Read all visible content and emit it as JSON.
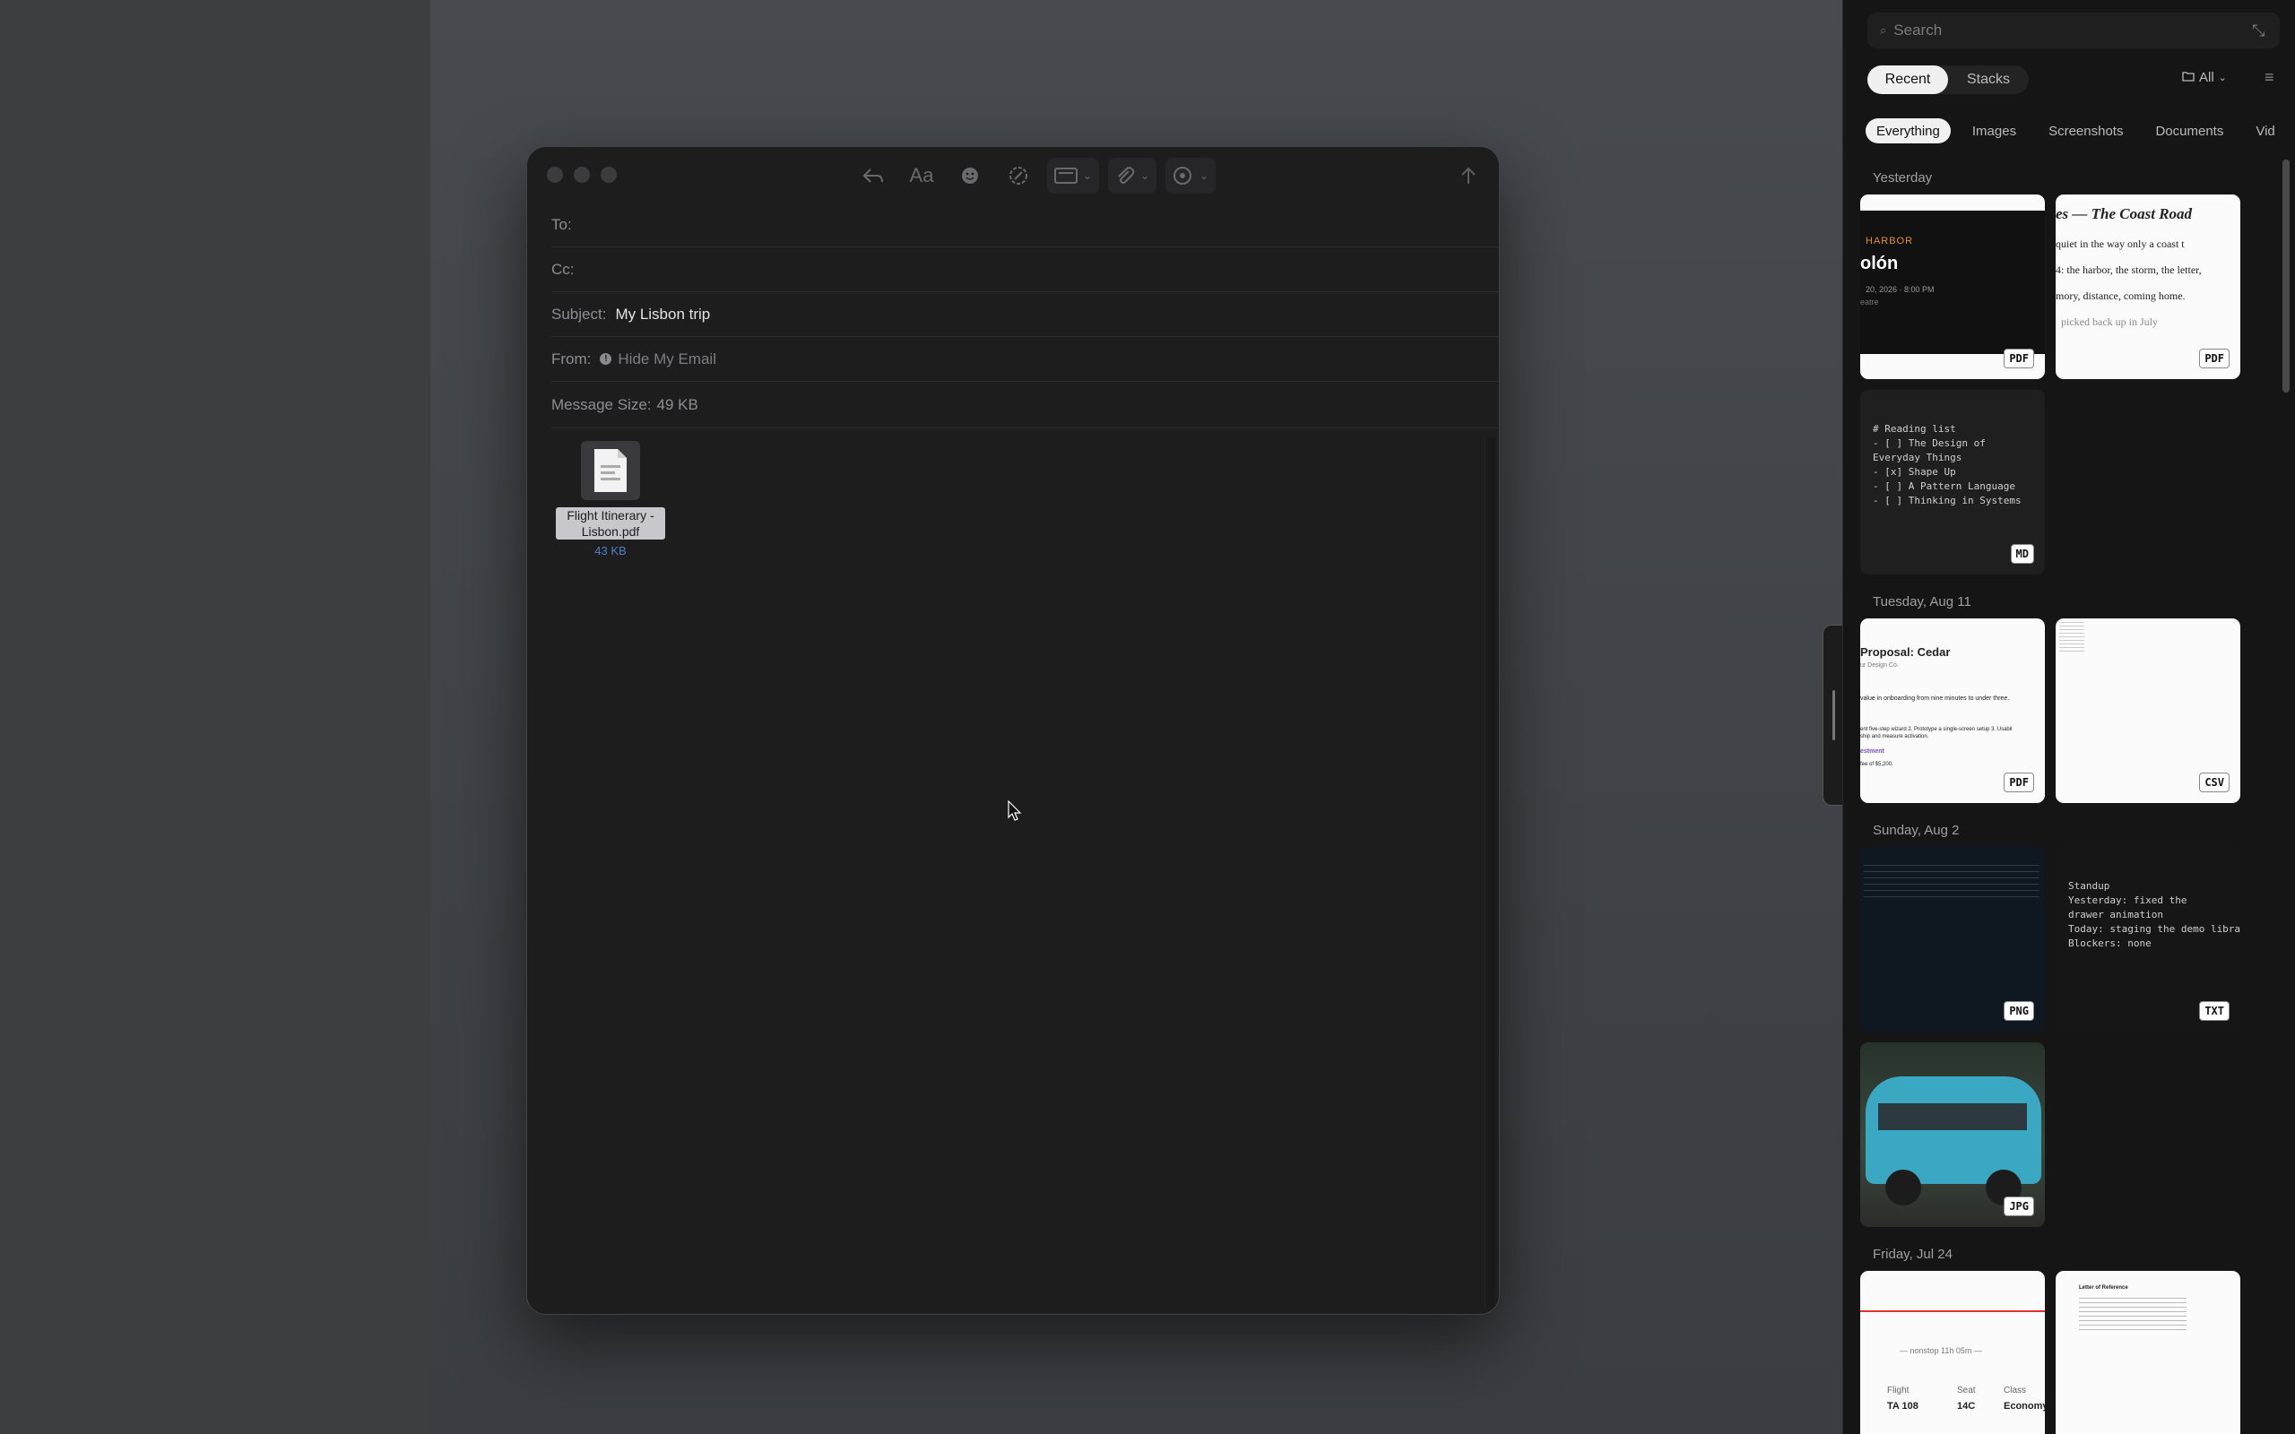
{
  "mail": {
    "to_label": "To:",
    "cc_label": "Cc:",
    "subject_label": "Subject:",
    "subject_value": "My Lisbon trip",
    "from_label": "From:",
    "from_value": "Hide My Email",
    "size_label": "Message Size:",
    "size_value": "49 KB",
    "attachment": {
      "name": "Flight Itinerary - Lisbon.pdf",
      "size": "43 KB"
    },
    "toolbar": {
      "format_label": "Aa"
    }
  },
  "panel": {
    "search_placeholder": "Search",
    "tabs": [
      "Recent",
      "Stacks"
    ],
    "scope": "All",
    "chips": [
      "Everything",
      "Images",
      "Screenshots",
      "Documents",
      "Vid"
    ],
    "sections": [
      {
        "title": "Yesterday",
        "cards": [
          {
            "badge": "PDF",
            "lines": [
              "HARBOR",
              "olón",
              "20, 2026 · 8:00 PM",
              "eatre"
            ]
          },
          {
            "badge": "PDF",
            "lines": [
              "es — The Coast Road",
              "quiet in the way only a coast t",
              "4: the harbor, the storm, the letter,",
              "mory, distance, coming home.",
              "picked back up in July"
            ]
          },
          {
            "badge": "MD",
            "text": "# Reading list\n- [ ] The Design of\nEveryday Things\n- [x] Shape Up\n- [ ] A Pattern Language\n- [ ] Thinking in Systems"
          }
        ]
      },
      {
        "title": "Tuesday, Aug 11",
        "cards": [
          {
            "badge": "PDF",
            "lines": [
              "Proposal: Cedar",
              "ur Design Co.",
              "value in onboarding from nine minutes to under three.",
              "ent five-step wizard  2. Prototype a single-screen setup  3. Usabil",
              "ship and measure activation.",
              "estment",
              "fee of $5,200."
            ]
          },
          {
            "badge": "CSV"
          }
        ]
      },
      {
        "title": "Sunday, Aug 2",
        "cards": [
          {
            "badge": "PNG"
          },
          {
            "badge": "TXT",
            "text": "Standup\nYesterday: fixed the\ndrawer animation\nToday: staging the demo library\nBlockers: none"
          },
          {
            "badge": "JPG"
          }
        ]
      },
      {
        "title": "Friday, Jul 24",
        "cards": [
          {
            "lines": [
              "— nonstop 11h 05m —",
              "Flight",
              "Seat",
              "Class",
              "TA 108",
              "14C",
              "Economy"
            ]
          },
          {
            "lines": [
              "Letter of Reference"
            ]
          }
        ]
      }
    ]
  }
}
